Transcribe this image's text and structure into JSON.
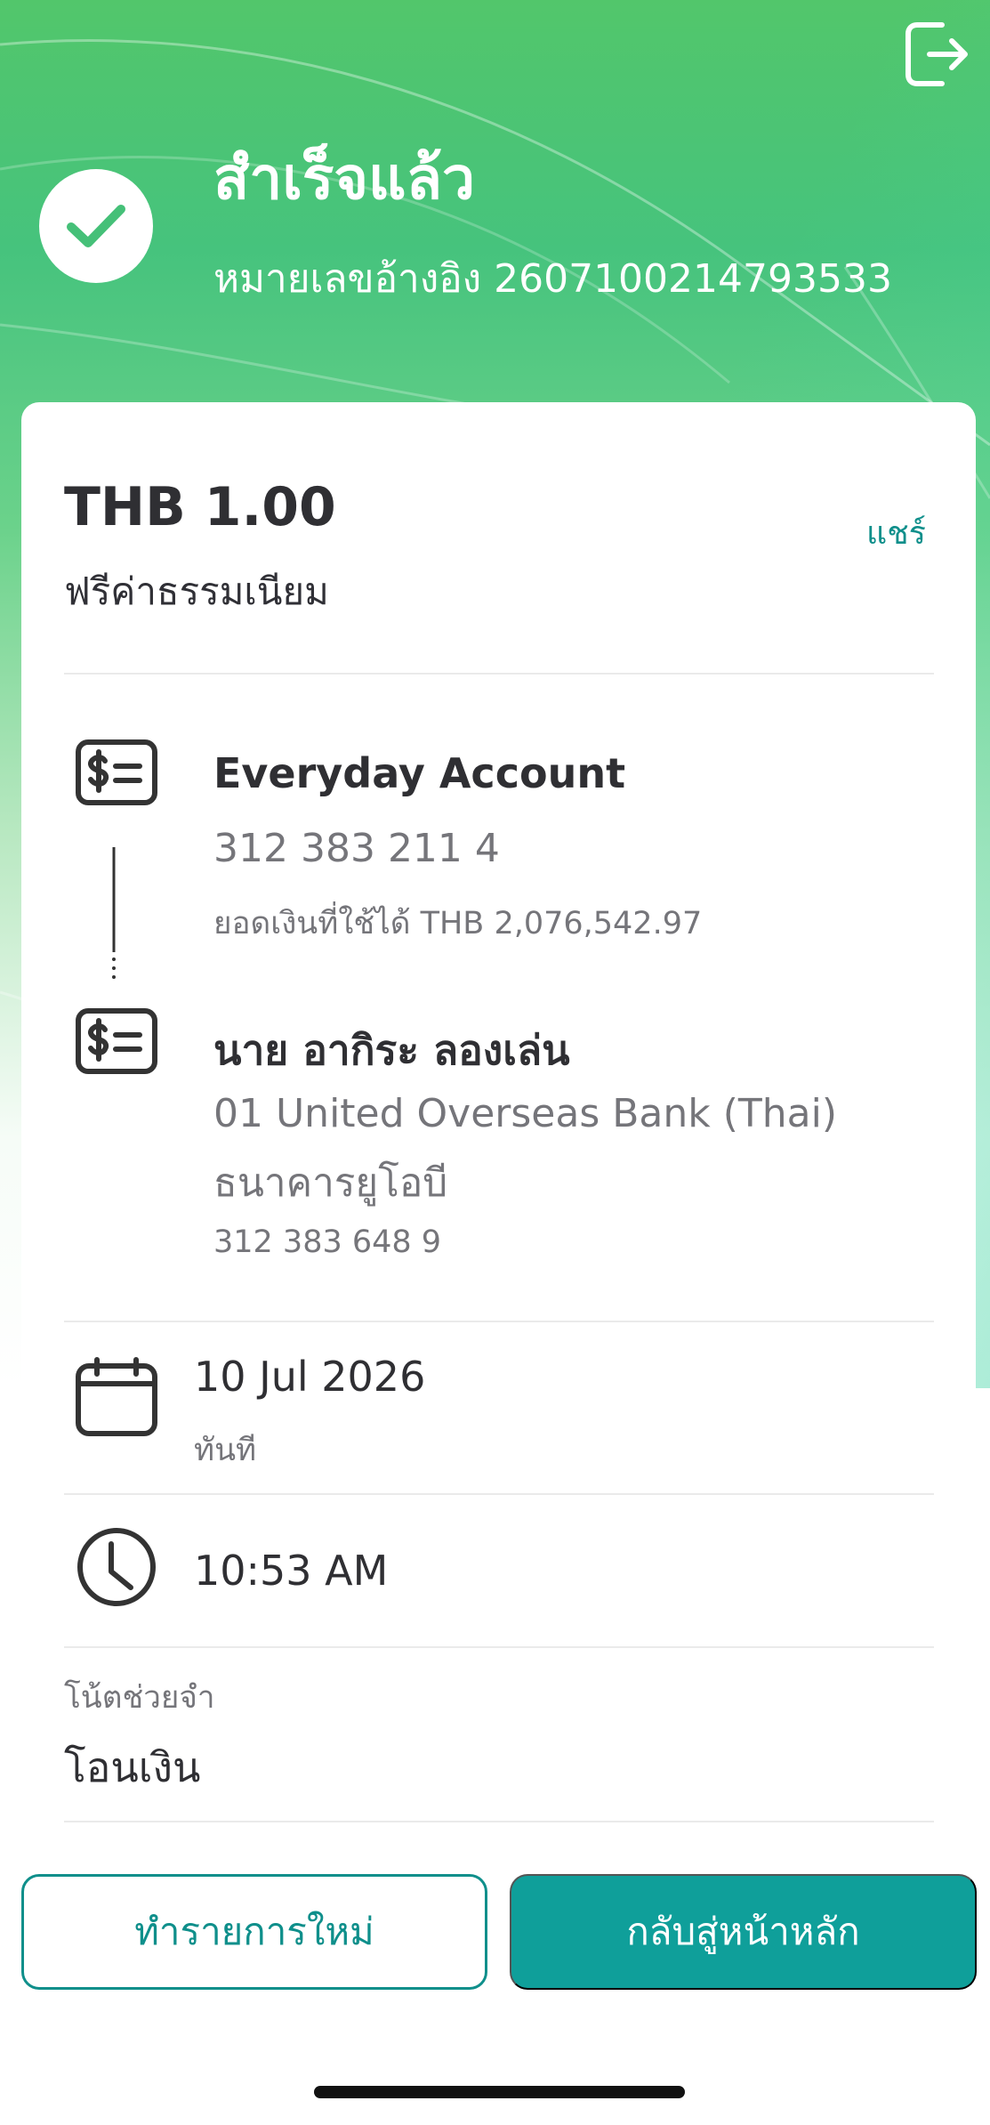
{
  "header": {
    "title": "สำเร็จแล้ว",
    "reference": "หมายเลขอ้างอิง 2607100214793533",
    "logout_icon": "logout-icon",
    "success_icon": "check-icon"
  },
  "transfer": {
    "amount": "THB 1.00",
    "fee": "ฟรีค่าธรรมเนียม",
    "share": "แชร์"
  },
  "source_account": {
    "name": "Everyday Account",
    "number": "312 383 211 4",
    "available_balance": "ยอดเงินที่ใช้ได้ THB 2,076,542.97",
    "icon": "money-account-icon"
  },
  "destination_account": {
    "name": "นาย อากิระ ลองเล่น",
    "bank_en": "01 United Overseas Bank (Thai)",
    "bank_th": "ธนาคารยูโอบี",
    "number": "312 383 648 9",
    "icon": "money-account-icon"
  },
  "schedule": {
    "date": "10 Jul 2026",
    "timing": "ทันที",
    "time": "10:53 AM",
    "calendar_icon": "calendar-icon",
    "clock_icon": "clock-icon"
  },
  "memo": {
    "label": "โน้ตช่วยจำ",
    "value": "โอนเงิน"
  },
  "actions": {
    "new_transaction": "ทำรายการใหม่",
    "back_home": "กลับสู่หน้าหลัก"
  },
  "colors": {
    "brand_green": "#46c37d",
    "accent_teal": "#0f9f9a",
    "text_dark": "#2f2f33",
    "text_muted": "#75757a"
  }
}
